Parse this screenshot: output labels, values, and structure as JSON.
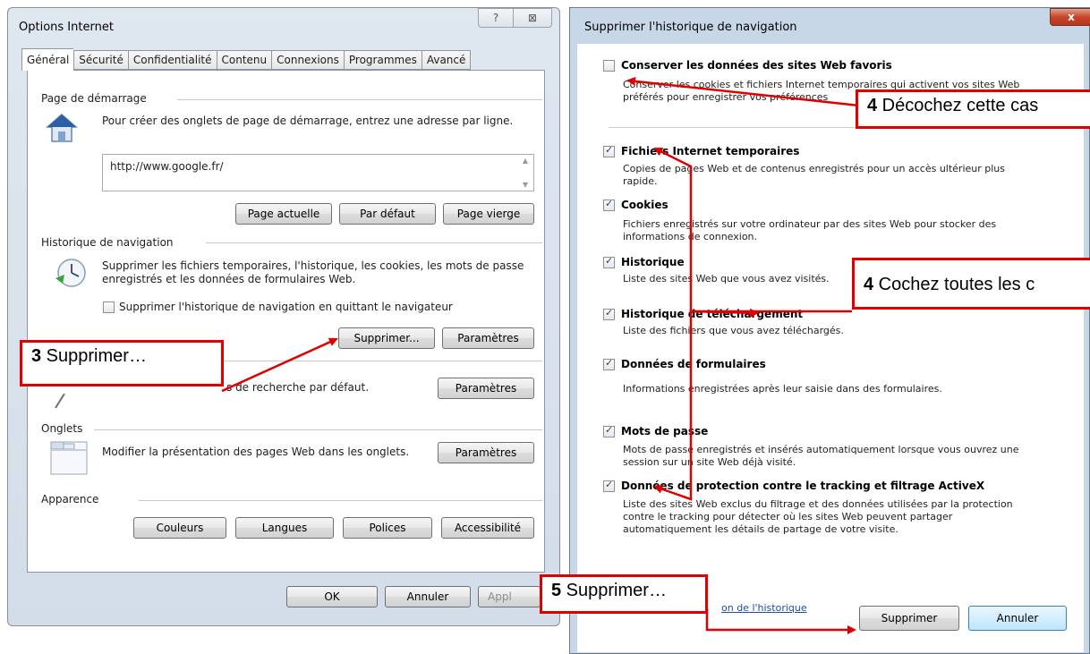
{
  "left_window": {
    "title": "Options Internet",
    "help_glyph": "?",
    "close_glyph": "⊠",
    "tabs": [
      "Général",
      "Sécurité",
      "Confidentialité",
      "Contenu",
      "Connexions",
      "Programmes",
      "Avancé"
    ],
    "start_page": {
      "heading": "Page de démarrage",
      "description": "Pour créer des onglets de page de démarrage, entrez une adresse par ligne.",
      "url": "http://www.google.fr/",
      "buttons": [
        "Page actuelle",
        "Par défaut",
        "Page vierge"
      ]
    },
    "history": {
      "heading": "Historique de navigation",
      "description_line1": "Supprimer les fichiers temporaires, l'historique, les cookies, les mots de passe",
      "description_line2": "enregistrés et les données de formulaires Web.",
      "checkbox_label": "Supprimer l'historique de navigation en quittant le navigateur",
      "checkbox_checked": false,
      "delete_button": "Supprimer...",
      "settings_button": "Paramètres"
    },
    "search": {
      "description": "s de recherche par défaut.",
      "settings_button": "Paramètres"
    },
    "tabs_group": {
      "heading": "Onglets",
      "description": "Modifier la présentation des pages Web dans les onglets.",
      "settings_button": "Paramètres"
    },
    "appearance": {
      "heading": "Apparence",
      "buttons": [
        "Couleurs",
        "Langues",
        "Polices",
        "Accessibilité"
      ]
    },
    "footer": {
      "ok": "OK",
      "cancel": "Annuler",
      "apply": "Appl"
    }
  },
  "right_window": {
    "title": "Supprimer l'historique de navigation",
    "close_glyph": "x",
    "items": [
      {
        "label": "Conserver les données des sites Web favoris",
        "checked": false,
        "desc1": "Conserver les cookies et fichiers Internet temporaires qui activent vos sites Web",
        "desc2": "préférés pour enregistrer vos préférences"
      },
      {
        "label": "Fichiers Internet temporaires",
        "checked": true,
        "desc1": "Copies de pages Web et de contenus enregistrés pour un accès ultérieur plus",
        "desc2": "rapide."
      },
      {
        "label": "Cookies",
        "checked": true,
        "desc1": "Fichiers enregistrés sur votre ordinateur par des sites Web pour stocker des",
        "desc2": "informations de connexion."
      },
      {
        "label": "Historique",
        "checked": true,
        "desc1": "Liste des sites Web que vous avez visités.",
        "desc2": ""
      },
      {
        "label": "Historique de téléchargement",
        "checked": true,
        "desc1": "Liste des fichiers que vous avez téléchargés.",
        "desc2": ""
      },
      {
        "label": "Données de formulaires",
        "checked": true,
        "desc1": "Informations enregistrées après leur saisie dans des formulaires.",
        "desc2": ""
      },
      {
        "label": "Mots de passe",
        "checked": true,
        "desc1": "Mots de passe enregistrés et insérés automatiquement lorsque vous ouvrez une",
        "desc2": "session sur un site Web déjà visité."
      },
      {
        "label": "Données de protection contre le tracking et filtrage ActiveX",
        "checked": true,
        "desc1": "Liste des sites Web exclus du filtrage et des données utilisées par la protection",
        "desc2": "contre le tracking pour détecter où les sites Web peuvent partager",
        "desc3": "automatiquement les détails de partage de votre visite."
      }
    ],
    "link": "on de l'historique",
    "delete_button": "Supprimer",
    "cancel_button": "Annuler"
  },
  "annotations": {
    "step3": {
      "num": "3",
      "text": " Supprimer…"
    },
    "step4a": {
      "num": "4",
      "text": " Décochez cette cas"
    },
    "step4b": {
      "num": "4",
      "text": " Cochez toutes les c"
    },
    "step5": {
      "num": "5",
      "text": " Supprimer…"
    },
    "color": "#e00000"
  }
}
